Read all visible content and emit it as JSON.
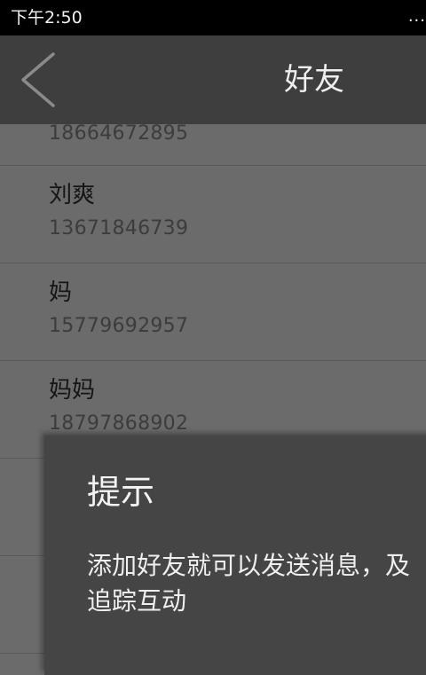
{
  "status_bar": {
    "time": "下午2:50",
    "more_indicator": "..."
  },
  "header": {
    "back_icon": "chevron-left-icon",
    "title": "好友"
  },
  "contacts": {
    "partial_phone": "18664672895",
    "items": [
      {
        "name": "刘爽",
        "phone": "13671846739"
      },
      {
        "name": "妈",
        "phone": "15779692957"
      },
      {
        "name": "妈妈",
        "phone": "18797868902"
      }
    ]
  },
  "dialog": {
    "title": "提示",
    "message": "添加好友就可以发送消息，及追踪互动"
  },
  "colors": {
    "status_bar_bg": "#000000",
    "app_bar_bg": "#3e3e3e",
    "list_bg": "#6b6b6b",
    "dialog_bg": "#454545"
  }
}
